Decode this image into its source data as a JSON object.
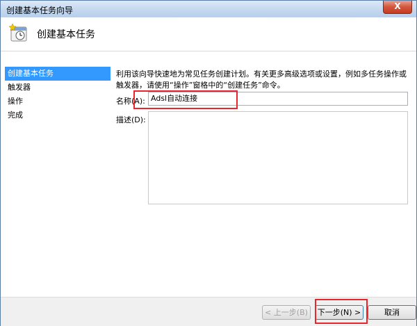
{
  "window": {
    "title": "创建基本任务向导",
    "close_label": "X"
  },
  "header": {
    "title": "创建基本任务"
  },
  "nav": {
    "items": [
      {
        "label": "创建基本任务",
        "active": true
      },
      {
        "label": "触发器"
      },
      {
        "label": "操作"
      },
      {
        "label": "完成"
      }
    ]
  },
  "main": {
    "description": "利用该向导快速地为常见任务创建计划。有关更多高级选项或设置，例如多任务操作或触发器，请使用“操作”窗格中的“创建任务”命令。",
    "name_label": "名称(A):",
    "name_value": "Adsl自动连接",
    "desc_label": "描述(D):",
    "desc_value": ""
  },
  "footer": {
    "back_label": "< 上一步(B)",
    "next_label": "下一步(N) >",
    "cancel_label": "取消"
  },
  "colors": {
    "highlight": "#e8262c",
    "nav_active": "#3399ff"
  },
  "icons": {
    "header": "scheduled-task-wizard-icon"
  }
}
